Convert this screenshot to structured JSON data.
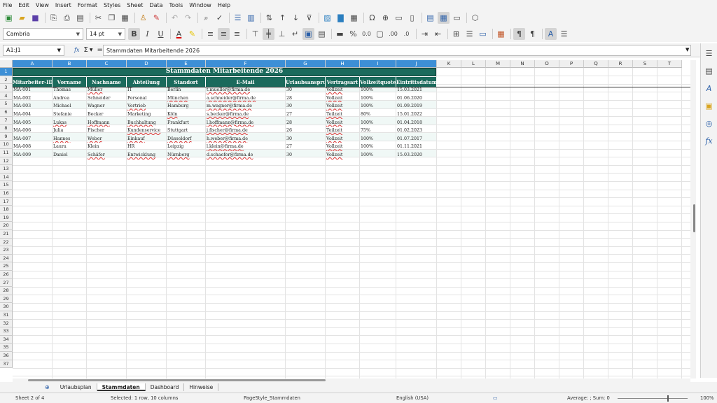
{
  "menu": [
    "File",
    "Edit",
    "View",
    "Insert",
    "Format",
    "Styles",
    "Sheet",
    "Data",
    "Tools",
    "Window",
    "Help"
  ],
  "toolbar": {
    "font_name": "Cambria",
    "font_size": "14 pt"
  },
  "formula_bar": {
    "name_box": "A1:J1",
    "sum_glyph": "Σ",
    "equals": "=",
    "content": "Stammdaten Mitarbeitende 2026",
    "fx": "fx"
  },
  "columns": [
    "A",
    "B",
    "C",
    "D",
    "E",
    "F",
    "G",
    "H",
    "I",
    "J",
    "K",
    "L",
    "M",
    "N",
    "O",
    "P",
    "Q",
    "R",
    "S",
    "T"
  ],
  "rows": [
    "1",
    "2",
    "3",
    "4",
    "5",
    "6",
    "7",
    "8",
    "9",
    "10",
    "11",
    "12",
    "13",
    "14",
    "15",
    "16",
    "17",
    "18",
    "19",
    "20",
    "21",
    "22",
    "23",
    "24",
    "25",
    "26",
    "27",
    "28",
    "29",
    "30",
    "31",
    "32",
    "33",
    "34",
    "35",
    "36",
    "37"
  ],
  "sheet": {
    "title": "Stammdaten Mitarbeitende 2026",
    "headers": [
      "Mitarbeiter-ID",
      "Vorname",
      "Nachname",
      "Abteilung",
      "Standort",
      "E-Mail",
      "Urlaubsanspruch",
      "Vertragsart",
      "Vollzeitquote",
      "Eintrittsdatum"
    ],
    "data": [
      [
        "MA-001",
        "Thomas",
        "Müller",
        "IT",
        "Berlin",
        "t.mueller@firma.de",
        "30",
        "Vollzeit",
        "100%",
        "15.03.2021"
      ],
      [
        "MA-002",
        "Andrea",
        "Schneider",
        "Personal",
        "München",
        "a.schneider@firma.de",
        "28",
        "Vollzeit",
        "100%",
        "01.06.2020"
      ],
      [
        "MA-003",
        "Michael",
        "Wagner",
        "Vertrieb",
        "Hamburg",
        "m.wagner@firma.de",
        "30",
        "Vollzeit",
        "100%",
        "01.09.2019"
      ],
      [
        "MA-004",
        "Stefanie",
        "Becker",
        "Marketing",
        "Köln",
        "s.becker@firma.de",
        "27",
        "Teilzeit",
        "80%",
        "15.01.2022"
      ],
      [
        "MA-005",
        "Lukas",
        "Hoffmann",
        "Buchhaltung",
        "Frankfurt",
        "l.hoffmann@firma.de",
        "28",
        "Vollzeit",
        "100%",
        "01.04.2018"
      ],
      [
        "MA-006",
        "Julia",
        "Fischer",
        "Kundenservice",
        "Stuttgart",
        "j.fischer@firma.de",
        "26",
        "Teilzeit",
        "75%",
        "01.02.2023"
      ],
      [
        "MA-007",
        "Hannes",
        "Weber",
        "Einkauf",
        "Düsseldorf",
        "h.weber@firma.de",
        "30",
        "Vollzeit",
        "100%",
        "01.07.2017"
      ],
      [
        "MA-008",
        "Laura",
        "Klein",
        "HR",
        "Leipzig",
        "l.klein@firma.de",
        "27",
        "Vollzeit",
        "100%",
        "01.11.2021"
      ],
      [
        "MA-009",
        "Daniel",
        "Schäfer",
        "Entwicklung",
        "Nürnberg",
        "d.schaefer@firma.de",
        "30",
        "Vollzeit",
        "100%",
        "15.03.2020"
      ]
    ]
  },
  "tabs": [
    "Urlaubsplan",
    "Stammdaten",
    "Dashboard",
    "Hinweise"
  ],
  "active_tab": "Stammdaten",
  "tab_add": "⊕",
  "status": {
    "sheet": "Sheet 2 of 4",
    "selection": "Selected: 1 row, 10 columns",
    "page_style": "PageStyle_Stammdaten",
    "language": "English (USA)",
    "sum": "Average: ; Sum: 0",
    "zoom": "100%"
  },
  "colors": {
    "header_bg": "#1b6a5c",
    "band": "#e6f3f0",
    "selection": "#3d8fd6"
  }
}
